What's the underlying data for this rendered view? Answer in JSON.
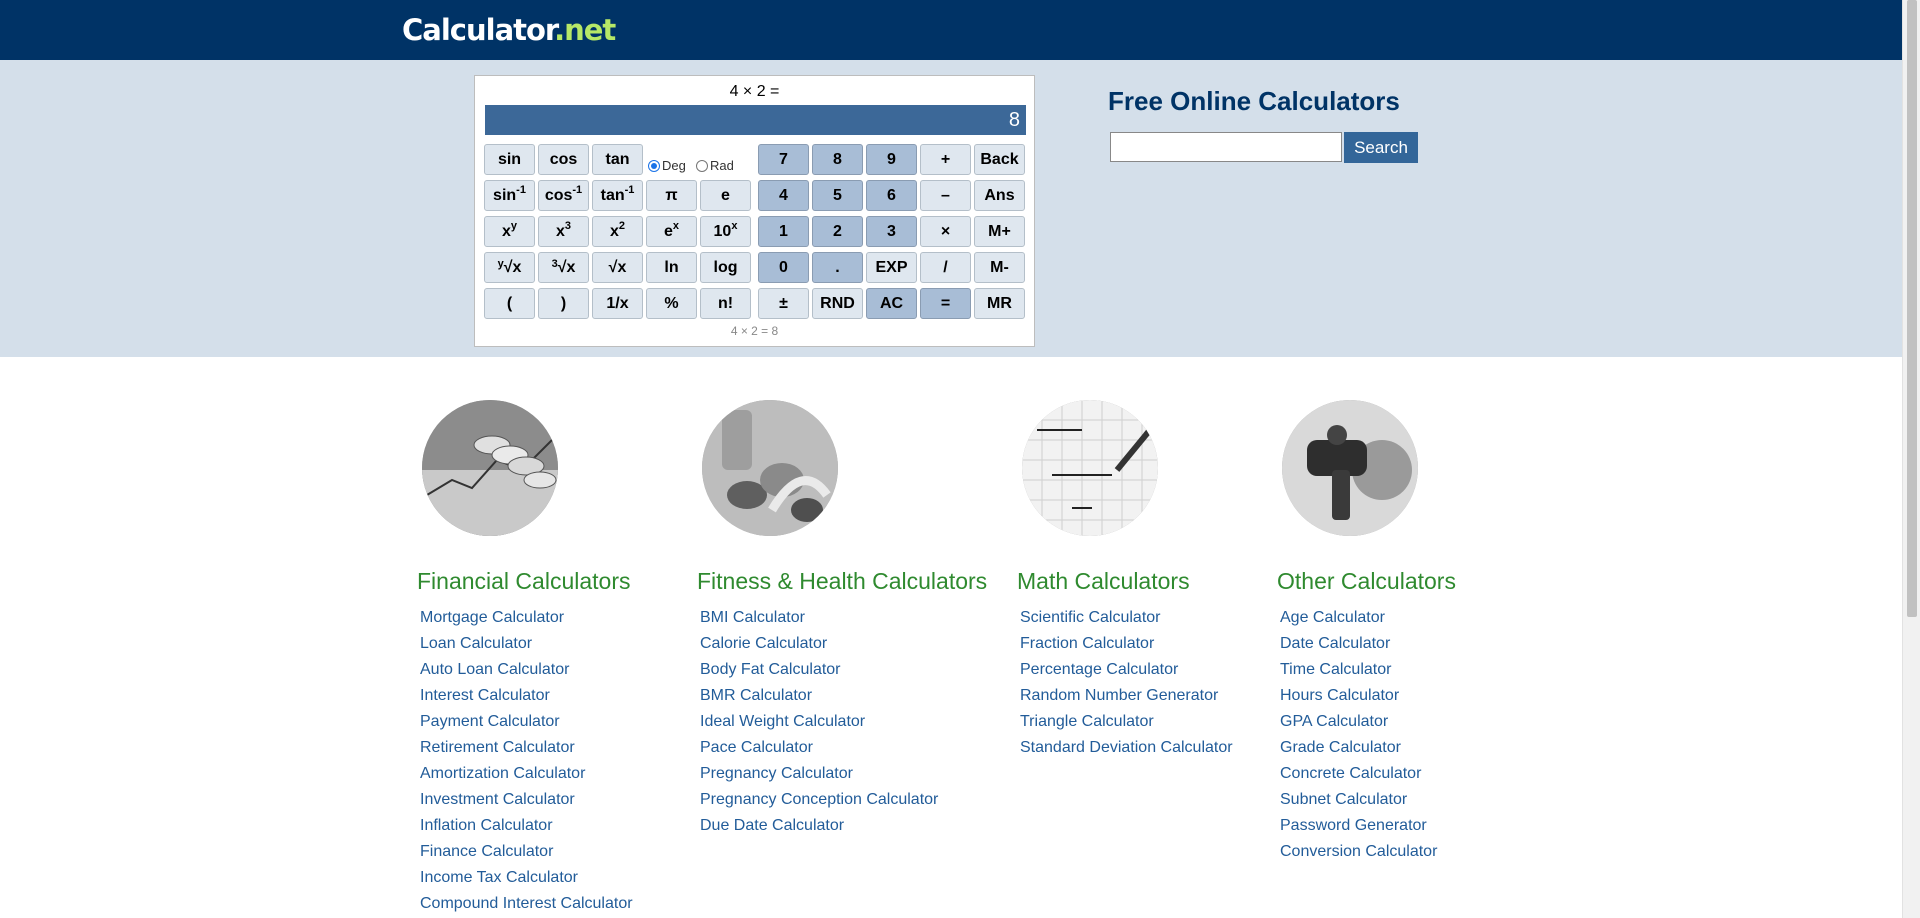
{
  "header": {
    "logo_main": "Calculator",
    "logo_tld": ".net"
  },
  "calculator": {
    "expression": "4 × 2 =",
    "display_value": "8",
    "angle_mode": {
      "options": [
        "Deg",
        "Rad"
      ],
      "selected": "Deg"
    },
    "footer_history": "4 × 2 = 8",
    "keys": {
      "sin": "sin",
      "cos": "cos",
      "tan": "tan",
      "asin_base": "sin",
      "acos_base": "cos",
      "atan_base": "tan",
      "inv_sup": "-1",
      "pow_base": "x",
      "pow_sup": "y",
      "cube_base": "x",
      "cube_sup": "3",
      "square_base": "x",
      "square_sup": "2",
      "exp_base": "e",
      "exp_sup": "x",
      "ten_base": "10",
      "ten_sup": "x",
      "yroot_pre": "y",
      "yroot_base": "√x",
      "cbrt_pre": "3",
      "cbrt_base": "√x",
      "sqrt": "√x",
      "ln": "ln",
      "log": "log",
      "pi": "π",
      "e": "e",
      "lparen": "(",
      "rparen": ")",
      "recip": "1/x",
      "percent": "%",
      "fact": "n!",
      "n7": "7",
      "n8": "8",
      "n9": "9",
      "n4": "4",
      "n5": "5",
      "n6": "6",
      "n1": "1",
      "n2": "2",
      "n3": "3",
      "n0": "0",
      "dot": ".",
      "plus": "+",
      "minus": "–",
      "times": "×",
      "divide": "/",
      "exp_key": "EXP",
      "plusminus": "±",
      "rnd": "RND",
      "ac": "AC",
      "equals": "=",
      "back": "Back",
      "ans": "Ans",
      "mplus": "M+",
      "mminus": "M-",
      "mr": "MR"
    }
  },
  "search": {
    "title": "Free Online Calculators",
    "input_value": "",
    "button_label": "Search"
  },
  "categories": [
    {
      "title": "Financial Calculators",
      "links": [
        "Mortgage Calculator",
        "Loan Calculator",
        "Auto Loan Calculator",
        "Interest Calculator",
        "Payment Calculator",
        "Retirement Calculator",
        "Amortization Calculator",
        "Investment Calculator",
        "Inflation Calculator",
        "Finance Calculator",
        "Income Tax Calculator",
        "Compound Interest Calculator"
      ]
    },
    {
      "title": "Fitness & Health Calculators",
      "links": [
        "BMI Calculator",
        "Calorie Calculator",
        "Body Fat Calculator",
        "BMR Calculator",
        "Ideal Weight Calculator",
        "Pace Calculator",
        "Pregnancy Calculator",
        "Pregnancy Conception Calculator",
        "Due Date Calculator"
      ]
    },
    {
      "title": "Math Calculators",
      "links": [
        "Scientific Calculator",
        "Fraction Calculator",
        "Percentage Calculator",
        "Random Number Generator",
        "Triangle Calculator",
        "Standard Deviation Calculator"
      ]
    },
    {
      "title": "Other Calculators",
      "links": [
        "Age Calculator",
        "Date Calculator",
        "Time Calculator",
        "Hours Calculator",
        "GPA Calculator",
        "Grade Calculator",
        "Concrete Calculator",
        "Subnet Calculator",
        "Password Generator",
        "Conversion Calculator"
      ]
    }
  ]
}
